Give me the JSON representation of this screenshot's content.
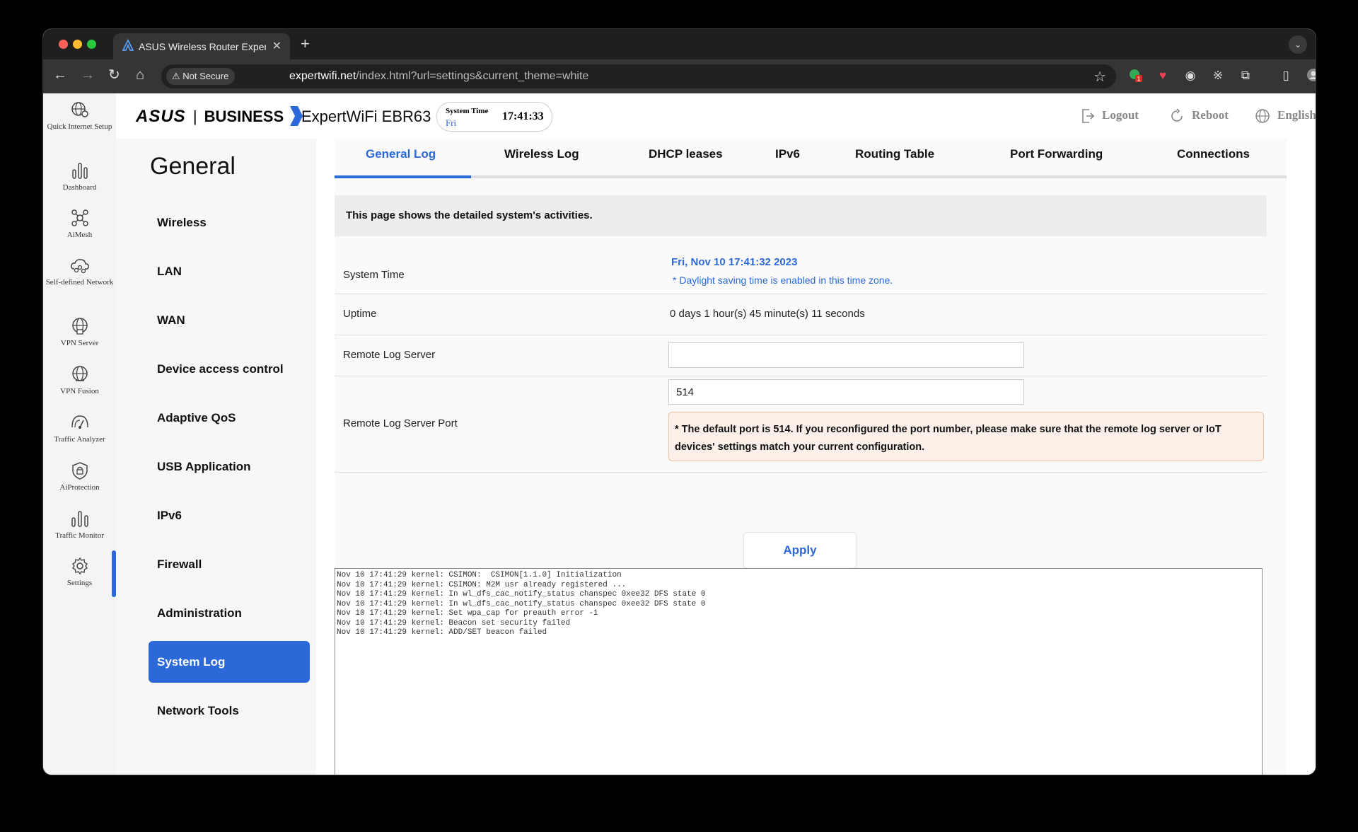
{
  "browser": {
    "tab_title": "ASUS Wireless Router Expert",
    "not_secure": "Not Secure",
    "url_host": "expertwifi.net",
    "url_path": "/index.html?url=settings&current_theme=white",
    "extension_badge": "1"
  },
  "leftnav": {
    "items": [
      {
        "label": "Quick Internet Setup",
        "icon": "globe-gear-icon"
      },
      {
        "label": "Dashboard",
        "icon": "bar-chart-icon"
      },
      {
        "label": "AiMesh",
        "icon": "mesh-icon"
      },
      {
        "label": "Self-defined Network",
        "icon": "network-cloud-icon"
      },
      {
        "label": "VPN Server",
        "icon": "vpn-server-icon"
      },
      {
        "label": "VPN Fusion",
        "icon": "vpn-fusion-icon"
      },
      {
        "label": "Traffic Analyzer",
        "icon": "traffic-analyzer-icon"
      },
      {
        "label": "AiProtection",
        "icon": "shield-icon"
      },
      {
        "label": "Traffic Monitor",
        "icon": "traffic-monitor-icon"
      },
      {
        "label": "Settings",
        "icon": "gear-icon"
      }
    ],
    "active": "Settings"
  },
  "header": {
    "brand": "ASUS",
    "brand_sub": "BUSINESS",
    "model": "ExpertWiFi EBR63",
    "system_time_label": "System Time",
    "system_time_day": "Fri",
    "system_time_clock": "17:41:33",
    "logout": "Logout",
    "reboot": "Reboot",
    "language": "English"
  },
  "submenu": {
    "title": "General",
    "items": [
      "Wireless",
      "LAN",
      "WAN",
      "Device access control",
      "Adaptive QoS",
      "USB Application",
      "IPv6",
      "Firewall",
      "Administration",
      "System Log",
      "Network Tools"
    ],
    "active": "System Log"
  },
  "tabs": [
    "General Log",
    "Wireless Log",
    "DHCP leases",
    "IPv6",
    "Routing Table",
    "Port Forwarding",
    "Connections"
  ],
  "active_tab": "General Log",
  "info": "This page shows the detailed system's activities.",
  "rows": {
    "system_time_label": "System Time",
    "system_time_value": "Fri, Nov 10 17:41:32 2023",
    "system_time_note": "* Daylight saving time is enabled in this time zone.",
    "uptime_label": "Uptime",
    "uptime_value": "0 days 1 hour(s) 45 minute(s) 11 seconds",
    "remote_server_label": "Remote Log Server",
    "remote_server_value": "",
    "remote_port_label": "Remote Log Server Port",
    "remote_port_value": "514",
    "port_warning": "* The default port is 514. If you reconfigured the port number, please make sure that the remote log server or IoT devices' settings match your current configuration."
  },
  "apply_label": "Apply",
  "log_lines": [
    "Nov 10 17:41:29 kernel: CSIMON:  CSIMON[1.1.0] Initialization",
    "Nov 10 17:41:29 kernel: CSIMON: M2M usr already registered ...",
    "Nov 10 17:41:29 kernel: In wl_dfs_cac_notify_status chanspec 0xee32 DFS state 0",
    "Nov 10 17:41:29 kernel: In wl_dfs_cac_notify_status chanspec 0xee32 DFS state 0",
    "Nov 10 17:41:29 kernel: Set wpa_cap for preauth error -1",
    "Nov 10 17:41:29 kernel: Beacon set security failed",
    "Nov 10 17:41:29 kernel: ADD/SET beacon failed"
  ],
  "colors": {
    "accent": "#2b68d8",
    "warning_bg": "#fdf0e8"
  }
}
